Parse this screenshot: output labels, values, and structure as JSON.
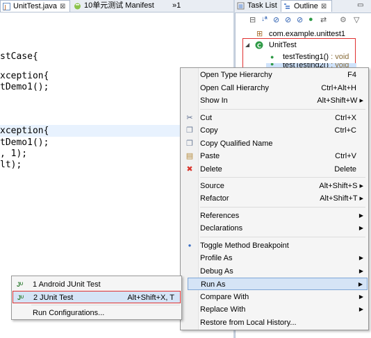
{
  "editor_tabs": [
    {
      "label": "UnitTest.java",
      "close": "⊠"
    },
    {
      "label": "10单元测试 Manifest"
    },
    {
      "label": "»1"
    }
  ],
  "code_lines": [
    "stCase{",
    "xception{",
    "tDemo1();",
    "xception{",
    "tDemo1();",
    ", 1);",
    "lt);"
  ],
  "right_tabs": [
    {
      "label": "Task List"
    },
    {
      "label": "Outline",
      "close": "⊠"
    }
  ],
  "outline": {
    "package": "com.example.unittest1",
    "class": "UnitTest",
    "methods": [
      {
        "name": "testTesting1()",
        "type": " : void"
      },
      {
        "name": "testTesting2()",
        "type": " : void"
      }
    ]
  },
  "context_menu": {
    "items": [
      {
        "label": "Open Type Hierarchy",
        "shortcut": "F4"
      },
      {
        "label": "Open Call Hierarchy",
        "shortcut": "Ctrl+Alt+H"
      },
      {
        "label": "Show In",
        "shortcut": "Alt+Shift+W ▸"
      },
      {
        "label": "Cut",
        "shortcut": "Ctrl+X"
      },
      {
        "label": "Copy",
        "shortcut": "Ctrl+C"
      },
      {
        "label": "Copy Qualified Name",
        "shortcut": ""
      },
      {
        "label": "Paste",
        "shortcut": "Ctrl+V"
      },
      {
        "label": "Delete",
        "shortcut": "Delete"
      },
      {
        "label": "Source",
        "shortcut": "Alt+Shift+S ▸"
      },
      {
        "label": "Refactor",
        "shortcut": "Alt+Shift+T ▸"
      },
      {
        "label": "References",
        "shortcut": ""
      },
      {
        "label": "Declarations",
        "shortcut": ""
      },
      {
        "label": "Toggle Method Breakpoint",
        "shortcut": ""
      },
      {
        "label": "Profile As",
        "shortcut": ""
      },
      {
        "label": "Debug As",
        "shortcut": ""
      },
      {
        "label": "Run As",
        "shortcut": ""
      },
      {
        "label": "Compare With",
        "shortcut": ""
      },
      {
        "label": "Replace With",
        "shortcut": ""
      },
      {
        "label": "Restore from Local History...",
        "shortcut": ""
      }
    ],
    "selected": "Run As"
  },
  "run_as_submenu": {
    "items": [
      {
        "label": "1 Android JUnit Test",
        "shortcut": ""
      },
      {
        "label": "2 JUnit Test",
        "shortcut": "Alt+Shift+X, T"
      },
      {
        "label": "Run Configurations...",
        "shortcut": ""
      }
    ],
    "selected": "2 JUnit Test"
  },
  "colors": {
    "accent_red": "#e03030",
    "selection_blue": "#d5e4f6",
    "highlight_line": "#e8f2fe"
  }
}
